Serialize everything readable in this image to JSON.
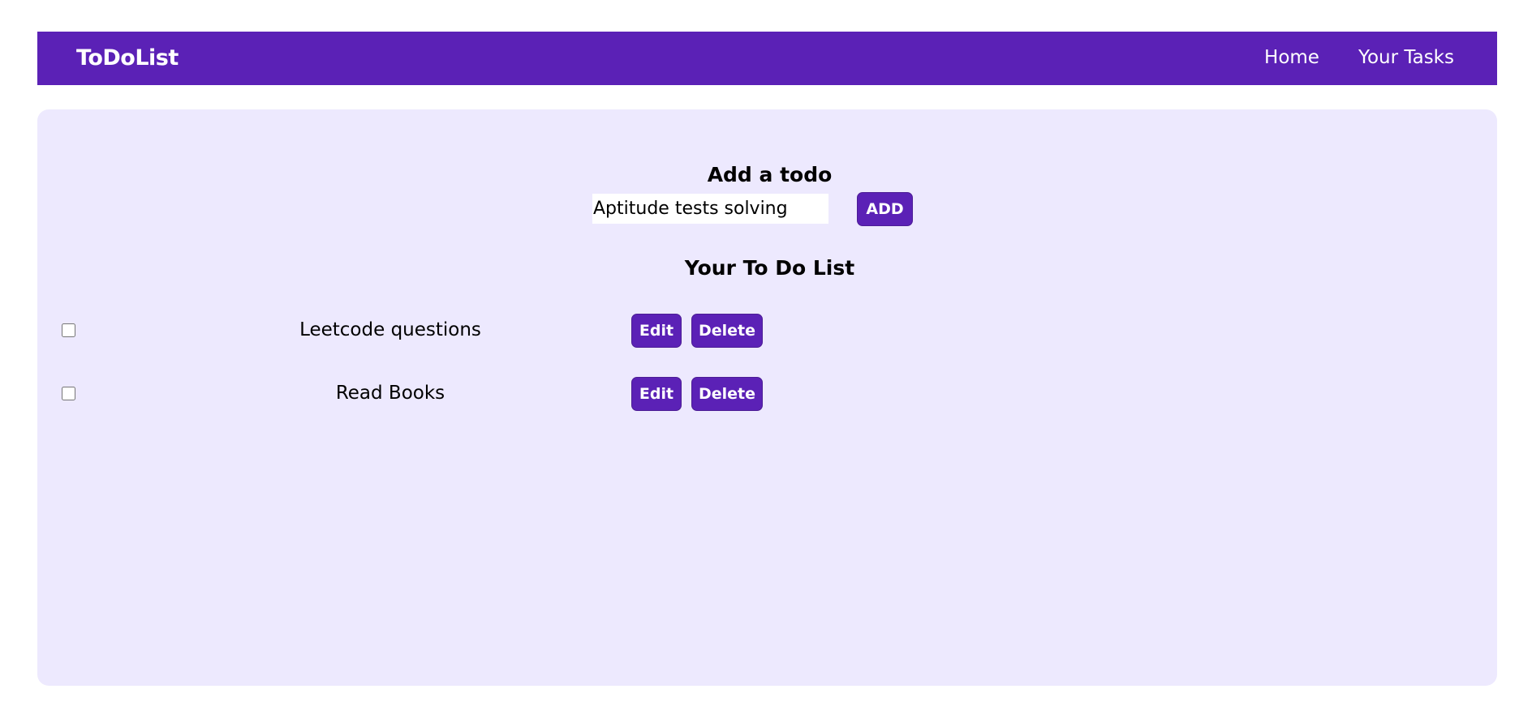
{
  "navbar": {
    "brand": "ToDoList",
    "links": [
      "Home",
      "Your Tasks"
    ]
  },
  "add_section": {
    "title": "Add a todo",
    "input_value": "Aptitude tests solving",
    "add_label": "ADD"
  },
  "list_section": {
    "title": "Your To Do List",
    "items": [
      {
        "text": "Leetcode questions",
        "checked": false,
        "edit_label": "Edit",
        "delete_label": "Delete"
      },
      {
        "text": "Read Books",
        "checked": false,
        "edit_label": "Edit",
        "delete_label": "Delete"
      }
    ]
  },
  "colors": {
    "primary": "#5b21b6",
    "card_background": "#ede9fe"
  }
}
